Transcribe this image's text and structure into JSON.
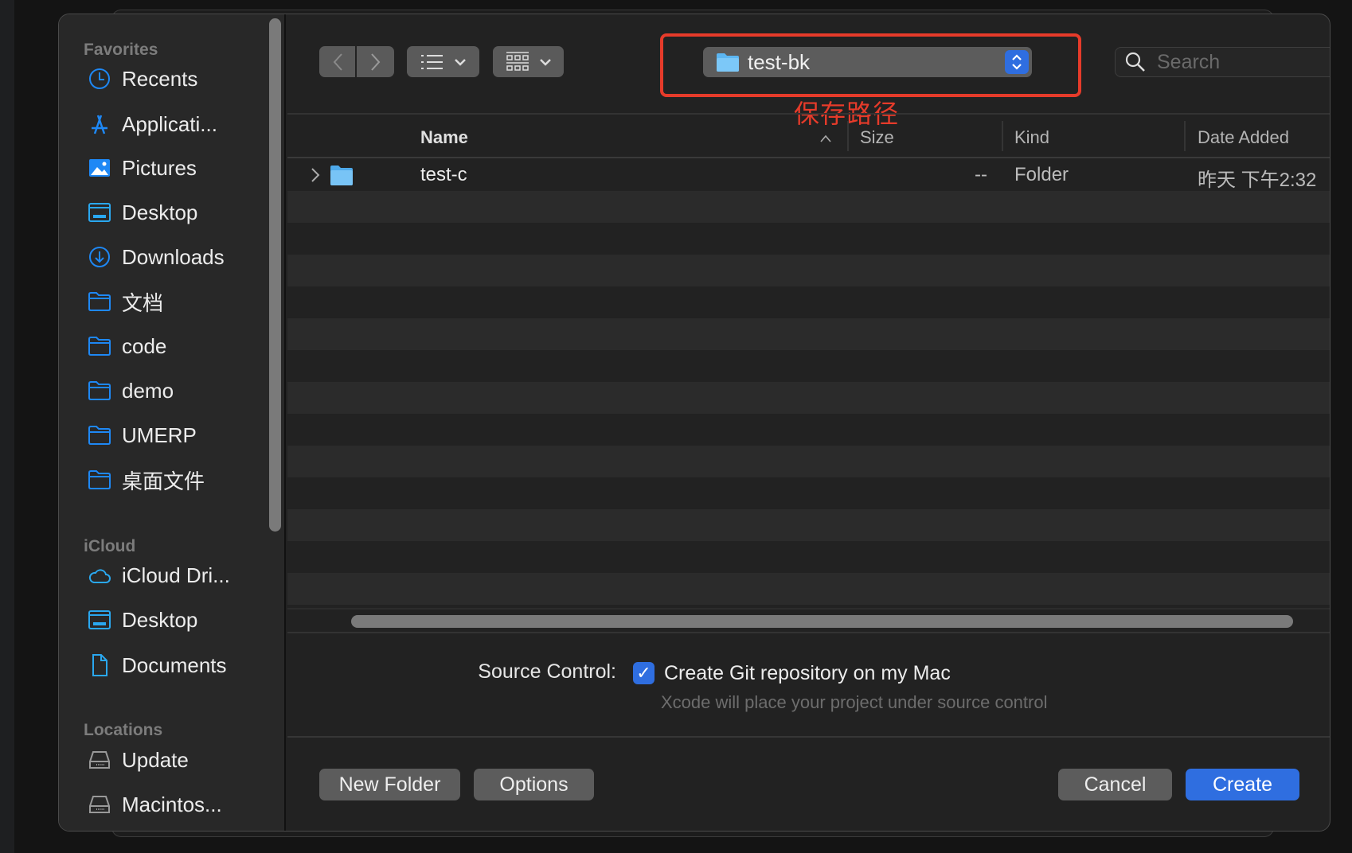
{
  "sidebar": {
    "sections": [
      {
        "title": "Favorites",
        "items": [
          {
            "label": "Recents",
            "icon": "clock-icon"
          },
          {
            "label": "Applicati...",
            "icon": "applications-icon"
          },
          {
            "label": "Pictures",
            "icon": "pictures-icon"
          },
          {
            "label": "Desktop",
            "icon": "desktop-icon"
          },
          {
            "label": "Downloads",
            "icon": "downloads-icon"
          },
          {
            "label": "文档",
            "icon": "folder-icon"
          },
          {
            "label": "code",
            "icon": "folder-icon"
          },
          {
            "label": "demo",
            "icon": "folder-icon"
          },
          {
            "label": "UMERP",
            "icon": "folder-icon"
          },
          {
            "label": "桌面文件",
            "icon": "folder-icon"
          }
        ]
      },
      {
        "title": "iCloud",
        "items": [
          {
            "label": "iCloud Dri...",
            "icon": "cloud-icon"
          },
          {
            "label": "Desktop",
            "icon": "desktop-icon"
          },
          {
            "label": "Documents",
            "icon": "document-icon"
          }
        ]
      },
      {
        "title": "Locations",
        "items": [
          {
            "label": "Update",
            "icon": "drive-icon"
          },
          {
            "label": "Macintos...",
            "icon": "drive-icon"
          }
        ]
      }
    ]
  },
  "toolbar": {
    "path": "test-bk",
    "search_placeholder": "Search",
    "annotation": "保存路径",
    "annotation_color": "#e63b2a"
  },
  "columns": [
    "Name",
    "Size",
    "Kind",
    "Date Added"
  ],
  "files": [
    {
      "name": "test-c",
      "size": "--",
      "kind": "Folder",
      "date_added": "昨天 下午2:32"
    }
  ],
  "source_control": {
    "label": "Source Control:",
    "checkbox_label": "Create Git repository on my Mac",
    "checked": true,
    "subtitle": "Xcode will place your project under source control"
  },
  "buttons": {
    "new_folder": "New Folder",
    "options": "Options",
    "cancel": "Cancel",
    "create": "Create"
  },
  "colors": {
    "accent": "#2f6ee0",
    "icon_blue": "#1e88f5"
  }
}
